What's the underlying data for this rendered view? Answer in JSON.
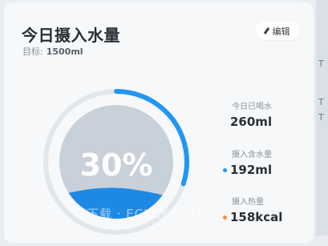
{
  "header": {
    "title": "今日摄入水量",
    "goal_label": "目标:",
    "goal_value": "1500ml",
    "edit_label": "编辑"
  },
  "gauge": {
    "percent_text": "30%",
    "progress": 0.3
  },
  "stats": [
    {
      "label": "今日已喝水",
      "value": "260ml"
    },
    {
      "label": "摄入含水量",
      "value": "192ml",
      "dot_color": "#2196f3"
    },
    {
      "label": "摄入热量",
      "value": "158kcal",
      "dot_color": "#ff8a3d"
    }
  ],
  "colors": {
    "accent": "#2196f3",
    "water": "#1e88e5",
    "gauge_fill": "#c8d0d9",
    "ring_track": "#e2e7ec",
    "calorie": "#ff8a3d"
  },
  "watermark": "飞下载 · ECXCY.COM",
  "right_strip": {
    "items": [
      "T",
      "T",
      "T"
    ]
  }
}
